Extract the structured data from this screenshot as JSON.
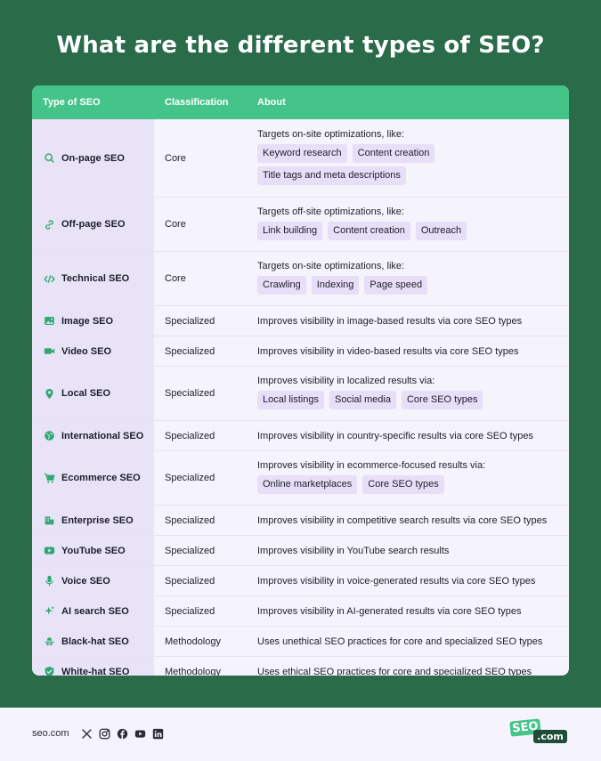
{
  "title": "What are the different types of SEO?",
  "colors": {
    "accent": "#45c48a",
    "background": "#2a6b4a",
    "rowTint": "#e9e3f8",
    "tagBg": "#e6dff7"
  },
  "table": {
    "headers": [
      "Type of SEO",
      "Classification",
      "About"
    ],
    "rows": [
      {
        "icon": "search-icon",
        "type": "On-page SEO",
        "classification": "Core",
        "about": "Targets on-site optimizations, like:",
        "tags": [
          "Keyword research",
          "Content creation",
          "Title tags and meta descriptions"
        ]
      },
      {
        "icon": "link-icon",
        "type": "Off-page SEO",
        "classification": "Core",
        "about": "Targets off-site optimizations, like:",
        "tags": [
          "Link building",
          "Content creation",
          "Outreach"
        ]
      },
      {
        "icon": "code-icon",
        "type": "Technical SEO",
        "classification": "Core",
        "about": "Targets on-site optimizations, like:",
        "tags": [
          "Crawling",
          "Indexing",
          "Page speed"
        ]
      },
      {
        "icon": "image-icon",
        "type": "Image SEO",
        "classification": "Specialized",
        "about": "Improves visibility in image-based results via core SEO types",
        "tags": []
      },
      {
        "icon": "video-icon",
        "type": "Video SEO",
        "classification": "Specialized",
        "about": "Improves visibility in video-based results via core SEO types",
        "tags": []
      },
      {
        "icon": "location-pin-icon",
        "type": "Local SEO",
        "classification": "Specialized",
        "about": "Improves visibility in localized results via:",
        "tags": [
          "Local listings",
          "Social media",
          "Core SEO types"
        ]
      },
      {
        "icon": "globe-icon",
        "type": "International SEO",
        "classification": "Specialized",
        "about": "Improves visibility in country-specific results via core SEO types",
        "tags": []
      },
      {
        "icon": "cart-icon",
        "type": "Ecommerce SEO",
        "classification": "Specialized",
        "about": "Improves visibility in ecommerce-focused results via:",
        "tags": [
          "Online marketplaces",
          "Core SEO types"
        ]
      },
      {
        "icon": "building-icon",
        "type": "Enterprise SEO",
        "classification": "Specialized",
        "about": "Improves visibility in competitive search results via core SEO types",
        "tags": []
      },
      {
        "icon": "youtube-icon",
        "type": "YouTube SEO",
        "classification": "Specialized",
        "about": "Improves visibility in YouTube search results",
        "tags": []
      },
      {
        "icon": "microphone-icon",
        "type": "Voice SEO",
        "classification": "Specialized",
        "about": "Improves visibility in voice-generated results via core SEO types",
        "tags": []
      },
      {
        "icon": "sparkle-icon",
        "type": "AI search SEO",
        "classification": "Specialized",
        "about": "Improves visibility in AI-generated results via core SEO types",
        "tags": []
      },
      {
        "icon": "black-hat-icon",
        "type": "Black-hat SEO",
        "classification": "Methodology",
        "about": "Uses unethical SEO practices for core and specialized SEO types",
        "tags": []
      },
      {
        "icon": "shield-check-icon",
        "type": "White-hat SEO",
        "classification": "Methodology",
        "about": "Uses ethical SEO practices for core and specialized SEO types",
        "tags": []
      }
    ]
  },
  "footer": {
    "site": "seo.com",
    "socials": [
      "x-icon",
      "instagram-icon",
      "facebook-icon",
      "youtube-icon",
      "linkedin-icon"
    ],
    "logo": {
      "part1": "SEO",
      "part2": ".com"
    }
  }
}
